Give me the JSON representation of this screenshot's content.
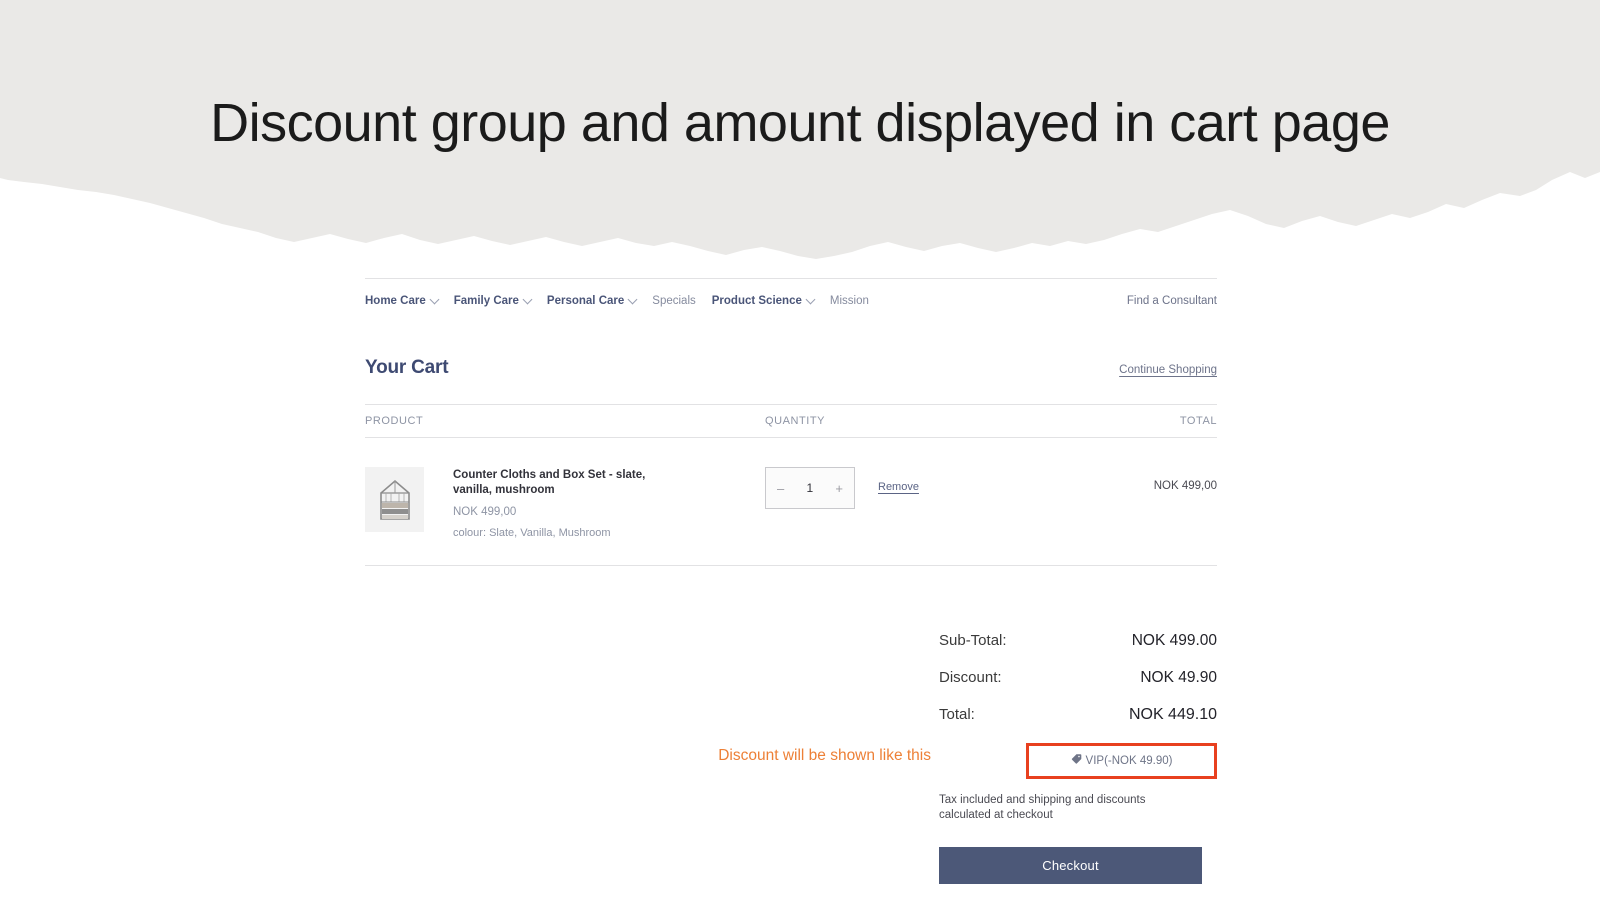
{
  "slide": {
    "title": "Discount group and amount displayed in cart page",
    "banner_color": "#eae9e7",
    "page_background": "#ffffff"
  },
  "nav": {
    "items": [
      {
        "label": "Home Care",
        "has_dropdown": true,
        "style": "bold"
      },
      {
        "label": "Family Care",
        "has_dropdown": true,
        "style": "bold"
      },
      {
        "label": "Personal Care",
        "has_dropdown": true,
        "style": "bold"
      },
      {
        "label": "Specials",
        "has_dropdown": false,
        "style": "plain"
      },
      {
        "label": "Product Science",
        "has_dropdown": true,
        "style": "bold"
      },
      {
        "label": "Mission",
        "has_dropdown": false,
        "style": "plain"
      }
    ],
    "find_consultant": "Find a Consultant",
    "chevron_icon": "chevron-down-icon"
  },
  "cart": {
    "title": "Your Cart",
    "continue_shopping": "Continue Shopping",
    "columns": {
      "product": "PRODUCT",
      "quantity": "QUANTITY",
      "total": "TOTAL"
    },
    "item": {
      "name": "Counter Cloths and Box Set - slate, vanilla, mushroom",
      "price": "NOK 499,00",
      "variant": "colour: Slate, Vanilla, Mushroom",
      "quantity": "1",
      "decrement_label": "–",
      "increment_label": "+",
      "remove_label": "Remove",
      "line_total": "NOK 499,00",
      "thumbnail_icon": "product-thumbnail"
    }
  },
  "totals": {
    "subtotal_label": "Sub-Total:",
    "subtotal_value": "NOK 499.00",
    "discount_label": "Discount:",
    "discount_value": "NOK 49.90",
    "total_label": "Total:",
    "total_value": "NOK 449.10",
    "vip_badge": "VIP(-NOK 49.90)",
    "vip_tag_icon": "tag-icon",
    "tax_note": "Tax included and shipping and discounts calculated at checkout",
    "checkout_label": "Checkout",
    "checkout_color": "#4c5878"
  },
  "annotation": {
    "text": "Discount will be shown like this",
    "text_color": "#ed8037",
    "highlight_border_color": "#e8401f"
  }
}
